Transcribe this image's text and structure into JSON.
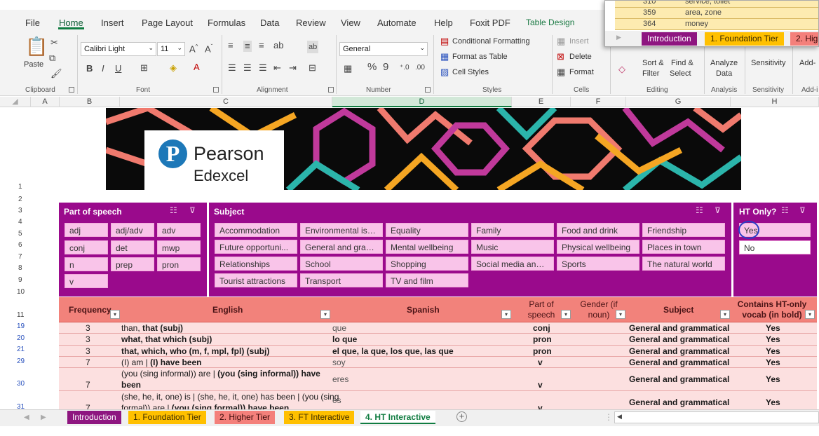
{
  "menu": {
    "items": [
      "File",
      "Home",
      "Insert",
      "Page Layout",
      "Formulas",
      "Data",
      "Review",
      "View",
      "Automate",
      "Help",
      "Foxit PDF",
      "Table Design"
    ]
  },
  "ribbon": {
    "clipboard": {
      "paste_label": "Paste",
      "group_label": "Clipboard"
    },
    "font": {
      "name": "Calibri Light",
      "size": "11",
      "group_label": "Font"
    },
    "alignment": {
      "group_label": "Alignment"
    },
    "number": {
      "format": "General",
      "group_label": "Number"
    },
    "styles": {
      "conditional": "Conditional Formatting",
      "format_table": "Format as Table",
      "cell_styles": "Cell Styles",
      "group_label": "Styles"
    },
    "cells": {
      "insert": "Insert",
      "delete": "Delete",
      "format": "Format",
      "group_label": "Cells"
    },
    "editing": {
      "sort": "Sort &",
      "filter": "Filter",
      "find": "Find &",
      "select": "Select",
      "group_label": "Editing"
    },
    "analysis": {
      "analyze": "Analyze",
      "data": "Data",
      "group_label": "Analysis"
    },
    "sensitivity": {
      "label": "Sensitivity",
      "group_label": "Sensitivity"
    },
    "addins": {
      "label": "Add-",
      "group_label": "Add-i"
    }
  },
  "columns": [
    "A",
    "B",
    "C",
    "D",
    "E",
    "F",
    "G",
    "H"
  ],
  "row_numbers": [
    "1",
    "2",
    "3",
    "4",
    "5",
    "6",
    "7",
    "8",
    "9",
    "10",
    "11",
    "19",
    "20",
    "21",
    "29",
    "30",
    "31"
  ],
  "brand": {
    "name": "Pearson",
    "sub": "Edexcel",
    "accent": "#1d78b8"
  },
  "slicers": {
    "pos": {
      "title": "Part of speech",
      "items": [
        "adj",
        "adj/adv",
        "adv",
        "conj",
        "det",
        "mwp",
        "n",
        "prep",
        "pron",
        "v"
      ]
    },
    "subject": {
      "title": "Subject",
      "items": [
        "Accommodation",
        "Environmental iss...",
        "Equality",
        "Family",
        "Food and drink",
        "Friendship",
        "Future opportuni...",
        "General and gram...",
        "Mental wellbeing",
        "Music",
        "Physical wellbeing",
        "Places in town",
        "Relationships",
        "School",
        "Shopping",
        "Social media and ...",
        "Sports",
        "The natural world",
        "Tourist attractions",
        "Transport",
        "TV and film"
      ]
    },
    "ht": {
      "title": "HT Only?",
      "items": [
        "Yes",
        "No"
      ]
    }
  },
  "table": {
    "headers": {
      "frequency": "Frequency",
      "english": "English",
      "spanish": "Spanish",
      "pos": "Part of speech",
      "gender": "Gender (if noun)",
      "subject": "Subject",
      "ht": "Contains HT-only vocab (in bold)"
    },
    "rows": [
      {
        "freq": "3",
        "en_plain": "than, ",
        "en_bold": "that (subj)",
        "es": "que",
        "pos": "conj",
        "subject": "General and grammatical",
        "ht": "Yes"
      },
      {
        "freq": "3",
        "en_plain": "",
        "en_bold": "what, that which (subj)",
        "es": "lo que",
        "pos": "pron",
        "subject": "General and grammatical",
        "ht": "Yes"
      },
      {
        "freq": "3",
        "en_plain": "",
        "en_bold": "that, which, who  (m, f, mpl, fpl) (subj)",
        "es": "el que, la que, los que, las que",
        "pos": "pron",
        "subject": "General and grammatical",
        "ht": "Yes"
      },
      {
        "freq": "7",
        "en_plain": "(I) am | ",
        "en_bold": "(I) have been",
        "es": "soy",
        "pos": "v",
        "subject": "General and grammatical",
        "ht": "Yes"
      },
      {
        "freq": "7",
        "en_line1_plain": "(you (sing informal)) are | ",
        "en_line1_bold": "(you (sing informal)) have",
        "en_line2_bold": "been",
        "es": "eres",
        "pos": "v",
        "subject": "General and grammatical",
        "ht": "Yes"
      },
      {
        "freq": "7",
        "en_line1_plain": "(she, he, it, one) is | (she, he, it, one) has been | (you (sing",
        "en_line2_plain": "formal)) are | ",
        "en_line2_bold": "(you (sing formal)) have been",
        "es": "es",
        "pos": "v",
        "subject": "General and grammatical",
        "ht": "Yes"
      }
    ]
  },
  "sheet_tabs": [
    {
      "label": "Introduction",
      "color": "#8e1680",
      "text": "#ffffff"
    },
    {
      "label": "1. Foundation Tier",
      "color": "#ffc000",
      "text": "#3b2a00"
    },
    {
      "label": "2. Higher Tier",
      "color": "#f4807b",
      "text": "#3b0a0a"
    },
    {
      "label": "3. FT Interactive",
      "color": "#ffc000",
      "text": "#3b2a00"
    },
    {
      "label": "4. HT Interactive",
      "color": "#ffffff",
      "text": "#107c41"
    }
  ],
  "popup": {
    "rows": [
      {
        "num": "310",
        "text": "service, toilet"
      },
      {
        "num": "359",
        "text": "area, zone"
      },
      {
        "num": "364",
        "text": "money"
      }
    ],
    "tabs": [
      "Introduction",
      "1. Foundation Tier",
      "2. Hig"
    ]
  },
  "colors": {
    "slicer": "#9a0a8c",
    "tile": "#f9c4e9",
    "header_row": "#f2827b",
    "row_fill": "#fbd9da",
    "excel_green": "#107c41"
  }
}
